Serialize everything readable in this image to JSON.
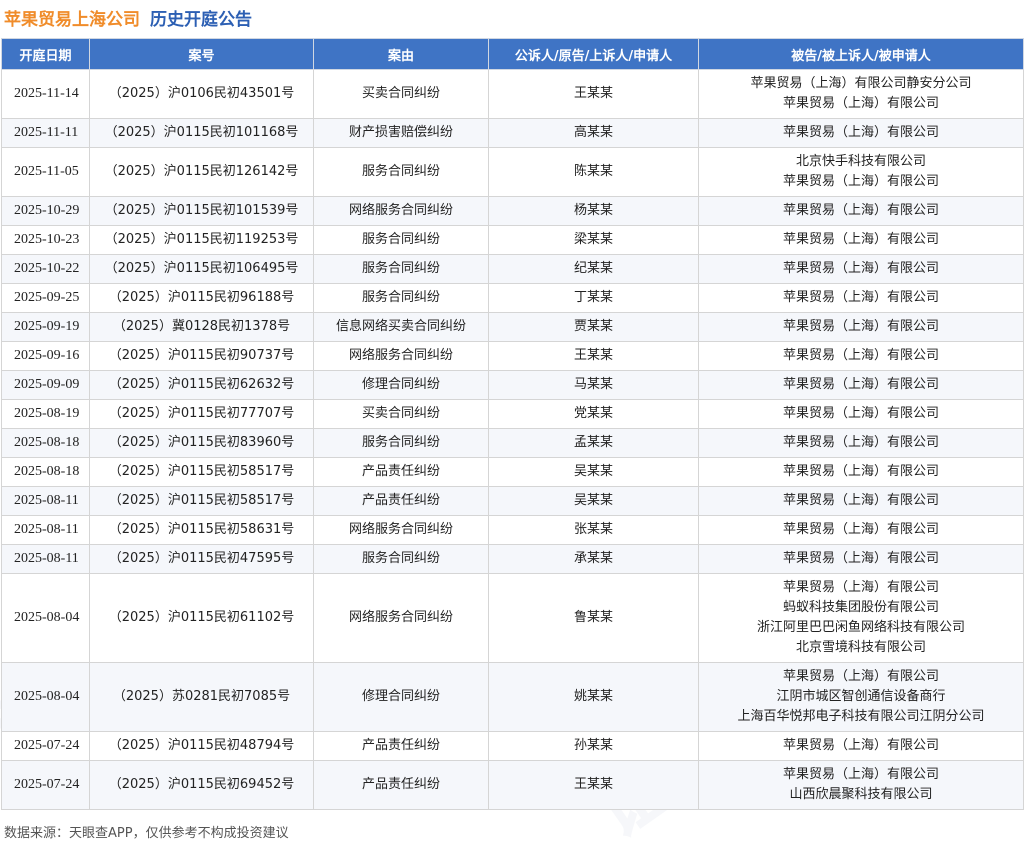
{
  "header": {
    "company": "苹果贸易上海公司",
    "subtitle": "历史开庭公告"
  },
  "table": {
    "columns": [
      "开庭日期",
      "案号",
      "案由",
      "公诉人/原告/上诉人/申请人",
      "被告/被上诉人/被申请人"
    ],
    "rows": [
      {
        "date": "2025-11-14",
        "case_no": "（2025）沪0106民初43501号",
        "cause": "买卖合同纠纷",
        "plaintiff": "王某某",
        "defendants": [
          "苹果贸易（上海）有限公司静安分公司",
          "苹果贸易（上海）有限公司"
        ]
      },
      {
        "date": "2025-11-11",
        "case_no": "（2025）沪0115民初101168号",
        "cause": "财产损害赔偿纠纷",
        "plaintiff": "高某某",
        "defendants": [
          "苹果贸易（上海）有限公司"
        ]
      },
      {
        "date": "2025-11-05",
        "case_no": "（2025）沪0115民初126142号",
        "cause": "服务合同纠纷",
        "plaintiff": "陈某某",
        "defendants": [
          "北京快手科技有限公司",
          "苹果贸易（上海）有限公司"
        ]
      },
      {
        "date": "2025-10-29",
        "case_no": "（2025）沪0115民初101539号",
        "cause": "网络服务合同纠纷",
        "plaintiff": "杨某某",
        "defendants": [
          "苹果贸易（上海）有限公司"
        ]
      },
      {
        "date": "2025-10-23",
        "case_no": "（2025）沪0115民初119253号",
        "cause": "服务合同纠纷",
        "plaintiff": "梁某某",
        "defendants": [
          "苹果贸易（上海）有限公司"
        ]
      },
      {
        "date": "2025-10-22",
        "case_no": "（2025）沪0115民初106495号",
        "cause": "服务合同纠纷",
        "plaintiff": "纪某某",
        "defendants": [
          "苹果贸易（上海）有限公司"
        ]
      },
      {
        "date": "2025-09-25",
        "case_no": "（2025）沪0115民初96188号",
        "cause": "服务合同纠纷",
        "plaintiff": "丁某某",
        "defendants": [
          "苹果贸易（上海）有限公司"
        ]
      },
      {
        "date": "2025-09-19",
        "case_no": "（2025）冀0128民初1378号",
        "cause": "信息网络买卖合同纠纷",
        "plaintiff": "贾某某",
        "defendants": [
          "苹果贸易（上海）有限公司"
        ]
      },
      {
        "date": "2025-09-16",
        "case_no": "（2025）沪0115民初90737号",
        "cause": "网络服务合同纠纷",
        "plaintiff": "王某某",
        "defendants": [
          "苹果贸易（上海）有限公司"
        ]
      },
      {
        "date": "2025-09-09",
        "case_no": "（2025）沪0115民初62632号",
        "cause": "修理合同纠纷",
        "plaintiff": "马某某",
        "defendants": [
          "苹果贸易（上海）有限公司"
        ]
      },
      {
        "date": "2025-08-19",
        "case_no": "（2025）沪0115民初77707号",
        "cause": "买卖合同纠纷",
        "plaintiff": "党某某",
        "defendants": [
          "苹果贸易（上海）有限公司"
        ]
      },
      {
        "date": "2025-08-18",
        "case_no": "（2025）沪0115民初83960号",
        "cause": "服务合同纠纷",
        "plaintiff": "孟某某",
        "defendants": [
          "苹果贸易（上海）有限公司"
        ]
      },
      {
        "date": "2025-08-18",
        "case_no": "（2025）沪0115民初58517号",
        "cause": "产品责任纠纷",
        "plaintiff": "吴某某",
        "defendants": [
          "苹果贸易（上海）有限公司"
        ]
      },
      {
        "date": "2025-08-11",
        "case_no": "（2025）沪0115民初58517号",
        "cause": "产品责任纠纷",
        "plaintiff": "吴某某",
        "defendants": [
          "苹果贸易（上海）有限公司"
        ]
      },
      {
        "date": "2025-08-11",
        "case_no": "（2025）沪0115民初58631号",
        "cause": "网络服务合同纠纷",
        "plaintiff": "张某某",
        "defendants": [
          "苹果贸易（上海）有限公司"
        ]
      },
      {
        "date": "2025-08-11",
        "case_no": "（2025）沪0115民初47595号",
        "cause": "服务合同纠纷",
        "plaintiff": "承某某",
        "defendants": [
          "苹果贸易（上海）有限公司"
        ]
      },
      {
        "date": "2025-08-04",
        "case_no": "（2025）沪0115民初61102号",
        "cause": "网络服务合同纠纷",
        "plaintiff": "鲁某某",
        "defendants": [
          "苹果贸易（上海）有限公司",
          "蚂蚁科技集团股份有限公司",
          "浙江阿里巴巴闲鱼网络科技有限公司",
          "北京雪境科技有限公司"
        ]
      },
      {
        "date": "2025-08-04",
        "case_no": "（2025）苏0281民初7085号",
        "cause": "修理合同纠纷",
        "plaintiff": "姚某某",
        "defendants": [
          "苹果贸易（上海）有限公司",
          "江阴市城区智创通信设备商行",
          "上海百华悦邦电子科技有限公司江阴分公司"
        ]
      },
      {
        "date": "2025-07-24",
        "case_no": "（2025）沪0115民初48794号",
        "cause": "产品责任纠纷",
        "plaintiff": "孙某某",
        "defendants": [
          "苹果贸易（上海）有限公司"
        ]
      },
      {
        "date": "2025-07-24",
        "case_no": "（2025）沪0115民初69452号",
        "cause": "产品责任纠纷",
        "plaintiff": "王某某",
        "defendants": [
          "苹果贸易（上海）有限公司",
          "山西欣晨聚科技有限公司"
        ]
      }
    ]
  },
  "footer": {
    "source": "数据来源：天眼查APP，仅供参考不构成投资建议"
  },
  "watermark": {
    "text": "证券之星"
  }
}
